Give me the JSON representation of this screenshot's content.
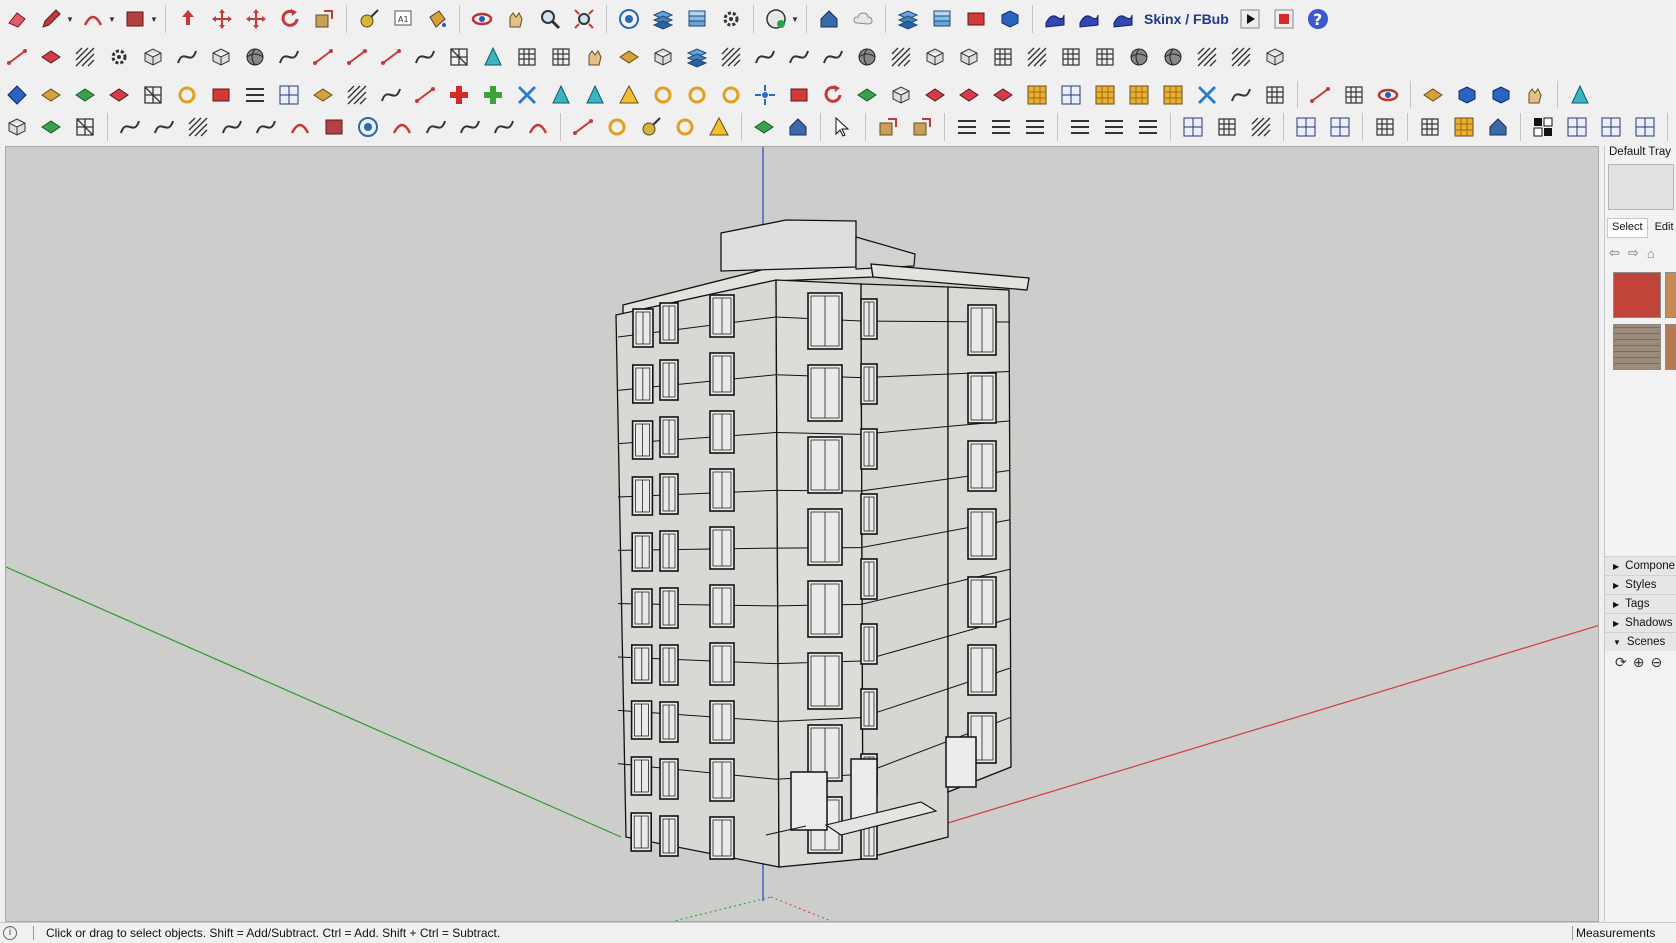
{
  "toolbar": {
    "brand_label": "Skinx / FBub"
  },
  "tray": {
    "title": "Default Tray",
    "tabs": [
      "Select",
      "Edit"
    ],
    "nav_icons": [
      "back-arrow-icon",
      "forward-arrow-icon",
      "home-icon"
    ],
    "swatch_colors": [
      "#c0443a",
      "#c58b57",
      "#9c8a7a",
      "#b47a54"
    ],
    "panels": [
      {
        "label": "Compone",
        "expanded": false
      },
      {
        "label": "Styles",
        "expanded": false
      },
      {
        "label": "Tags",
        "expanded": false
      },
      {
        "label": "Shadows",
        "expanded": false
      },
      {
        "label": "Scenes",
        "expanded": true
      }
    ]
  },
  "status": {
    "info_icon": "i",
    "hint": "Click or drag to select objects. Shift = Add/Subtract. Ctrl = Add. Shift + Ctrl = Subtract.",
    "measurements_label": "Measurements"
  },
  "viewport": {
    "background": "#cdcdcb",
    "axis_colors": {
      "red": "#d23b3b",
      "green": "#2d9a2d",
      "blue": "#2a3fd0"
    }
  }
}
